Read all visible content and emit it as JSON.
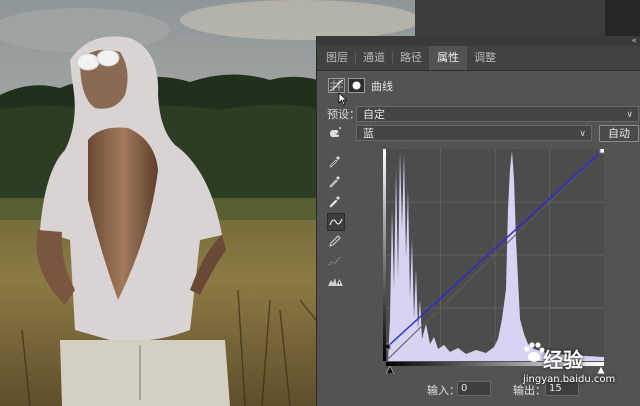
{
  "panel": {
    "tabs": [
      {
        "label": "图层",
        "active": false
      },
      {
        "label": "通道",
        "active": false
      },
      {
        "label": "路径",
        "active": false
      },
      {
        "label": "属性",
        "active": true
      },
      {
        "label": "调整",
        "active": false
      }
    ],
    "collapse_icon": "«",
    "title": "曲线",
    "preset_label": "预设：",
    "preset_value": "自定",
    "channel_value": "蓝",
    "auto_button": "自动",
    "input_label": "输入：",
    "input_value": "0",
    "output_label": "输出：",
    "output_value": "15",
    "tools": [
      "on-image-adjust-icon",
      "sample-black-eyedropper-icon",
      "sample-gray-eyedropper-icon",
      "sample-white-eyedropper-icon",
      "curve-point-icon",
      "pencil-draw-icon",
      "smooth-curve-icon",
      "clipping-warning-icon"
    ],
    "curve": {
      "color": "#2b2bd8",
      "histogram_color": "#d7d3f2"
    }
  },
  "watermark": {
    "title": "经验",
    "url": "jingyan.baidu.com"
  }
}
